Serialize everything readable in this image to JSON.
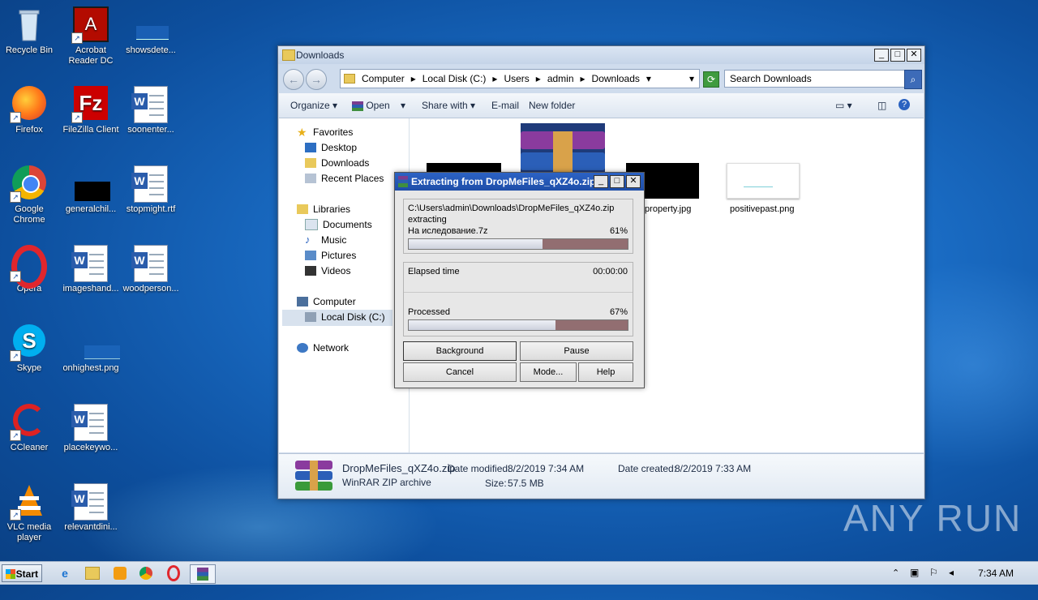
{
  "desktop": {
    "icons": [
      {
        "label": "Recycle Bin"
      },
      {
        "label": "Acrobat\nReader DC"
      },
      {
        "label": "showsdete..."
      },
      {
        "label": "Firefox"
      },
      {
        "label": "FileZilla Client"
      },
      {
        "label": "soonenter..."
      },
      {
        "label": "Google\nChrome"
      },
      {
        "label": "generalchil..."
      },
      {
        "label": "stopmight.rtf"
      },
      {
        "label": "Opera"
      },
      {
        "label": "imageshand..."
      },
      {
        "label": "woodperson..."
      },
      {
        "label": "Skype"
      },
      {
        "label": "onhighest.png"
      },
      {
        "label": "CCleaner"
      },
      {
        "label": "placekeywo..."
      },
      {
        "label": "VLC media\nplayer"
      },
      {
        "label": "relevantdini..."
      }
    ]
  },
  "explorer": {
    "title": "Downloads",
    "breadcrumb": [
      "Computer",
      "Local Disk (C:)",
      "Users",
      "admin",
      "Downloads"
    ],
    "search_placeholder": "Search Downloads",
    "toolbar": {
      "organize": "Organize",
      "open": "Open",
      "share_with": "Share with",
      "email": "E-mail",
      "new_folder": "New folder"
    },
    "nav": {
      "favorites": "Favorites",
      "desktop": "Desktop",
      "downloads": "Downloads",
      "recent": "Recent Places",
      "libraries": "Libraries",
      "documents": "Documents",
      "music": "Music",
      "pictures": "Pictures",
      "videos": "Videos",
      "computer": "Computer",
      "local_disk": "Local Disk (C:)",
      "network": "Network"
    },
    "files": [
      {
        "name": "tproperty.jpg"
      },
      {
        "name": "positivepast.png"
      }
    ],
    "details": {
      "filename": "DropMeFiles_qXZ4o.zip",
      "type": "WinRAR ZIP archive",
      "date_modified_label": "Date modified:",
      "date_modified": "8/2/2019 7:34 AM",
      "date_created_label": "Date created:",
      "date_created": "8/2/2019 7:33 AM",
      "size_label": "Size:",
      "size": "57.5 MB"
    }
  },
  "dialog": {
    "title": "Extracting from DropMeFiles_qXZ4o.zip",
    "path": "C:\\Users\\admin\\Downloads\\DropMeFiles_qXZ4o.zip",
    "status": "extracting",
    "current_file": "На иследование.7z",
    "file_percent": "61%",
    "file_progress": 0.61,
    "elapsed_label": "Elapsed time",
    "elapsed": "00:00:00",
    "processed_label": "Processed",
    "processed_percent": "67%",
    "processed_progress": 0.67,
    "buttons": {
      "background": "Background",
      "pause": "Pause",
      "cancel": "Cancel",
      "mode": "Mode...",
      "help": "Help"
    }
  },
  "taskbar": {
    "start": "Start",
    "clock": "7:34 AM"
  },
  "watermark": "ANY RUN"
}
